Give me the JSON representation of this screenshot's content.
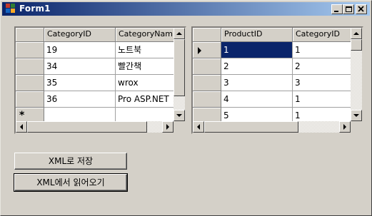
{
  "window": {
    "title": "Form1"
  },
  "left_grid": {
    "columns": [
      "CategoryID",
      "CategoryNam"
    ],
    "rows": [
      [
        "19",
        "노트북"
      ],
      [
        "34",
        "빨간책"
      ],
      [
        "35",
        "wrox"
      ],
      [
        "36",
        "Pro ASP.NET"
      ],
      [
        "",
        ""
      ]
    ],
    "new_row_marker": "*"
  },
  "right_grid": {
    "columns": [
      "ProductID",
      "CategoryID"
    ],
    "rows": [
      [
        "1",
        "1"
      ],
      [
        "2",
        "2"
      ],
      [
        "3",
        "3"
      ],
      [
        "4",
        "1"
      ],
      [
        "5",
        "1"
      ]
    ]
  },
  "buttons": {
    "save_xml": "XML로 저장",
    "load_xml": "XML에서 읽어오기"
  },
  "icons": {
    "app": "app-icon",
    "minimize": "minimize-icon",
    "maximize": "maximize-icon",
    "close": "close-icon",
    "current_row": "row-pointer-icon",
    "new_row": "new-row-icon"
  }
}
